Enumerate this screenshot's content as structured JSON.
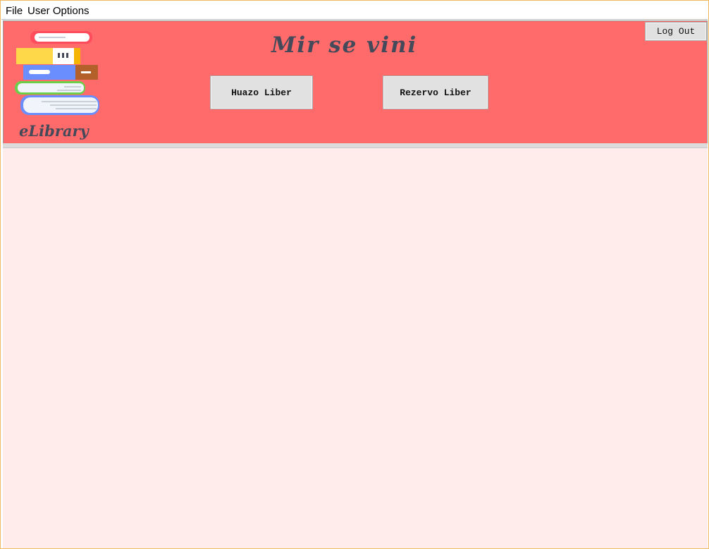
{
  "menu": {
    "file": "File",
    "user_options": "User Options"
  },
  "header": {
    "title": "Mir se vini",
    "logout_label": "Log Out",
    "logo_text": "eLibrary",
    "buttons": {
      "huazo": "Huazo Liber",
      "rezervo": "Rezervo Liber"
    }
  },
  "colors": {
    "header_bg": "#ff6b6b",
    "content_bg": "#ffeceb",
    "title_text": "#454a5a",
    "button_bg": "#e1e1e1"
  },
  "icons": {
    "logo": "books-stack-icon"
  }
}
